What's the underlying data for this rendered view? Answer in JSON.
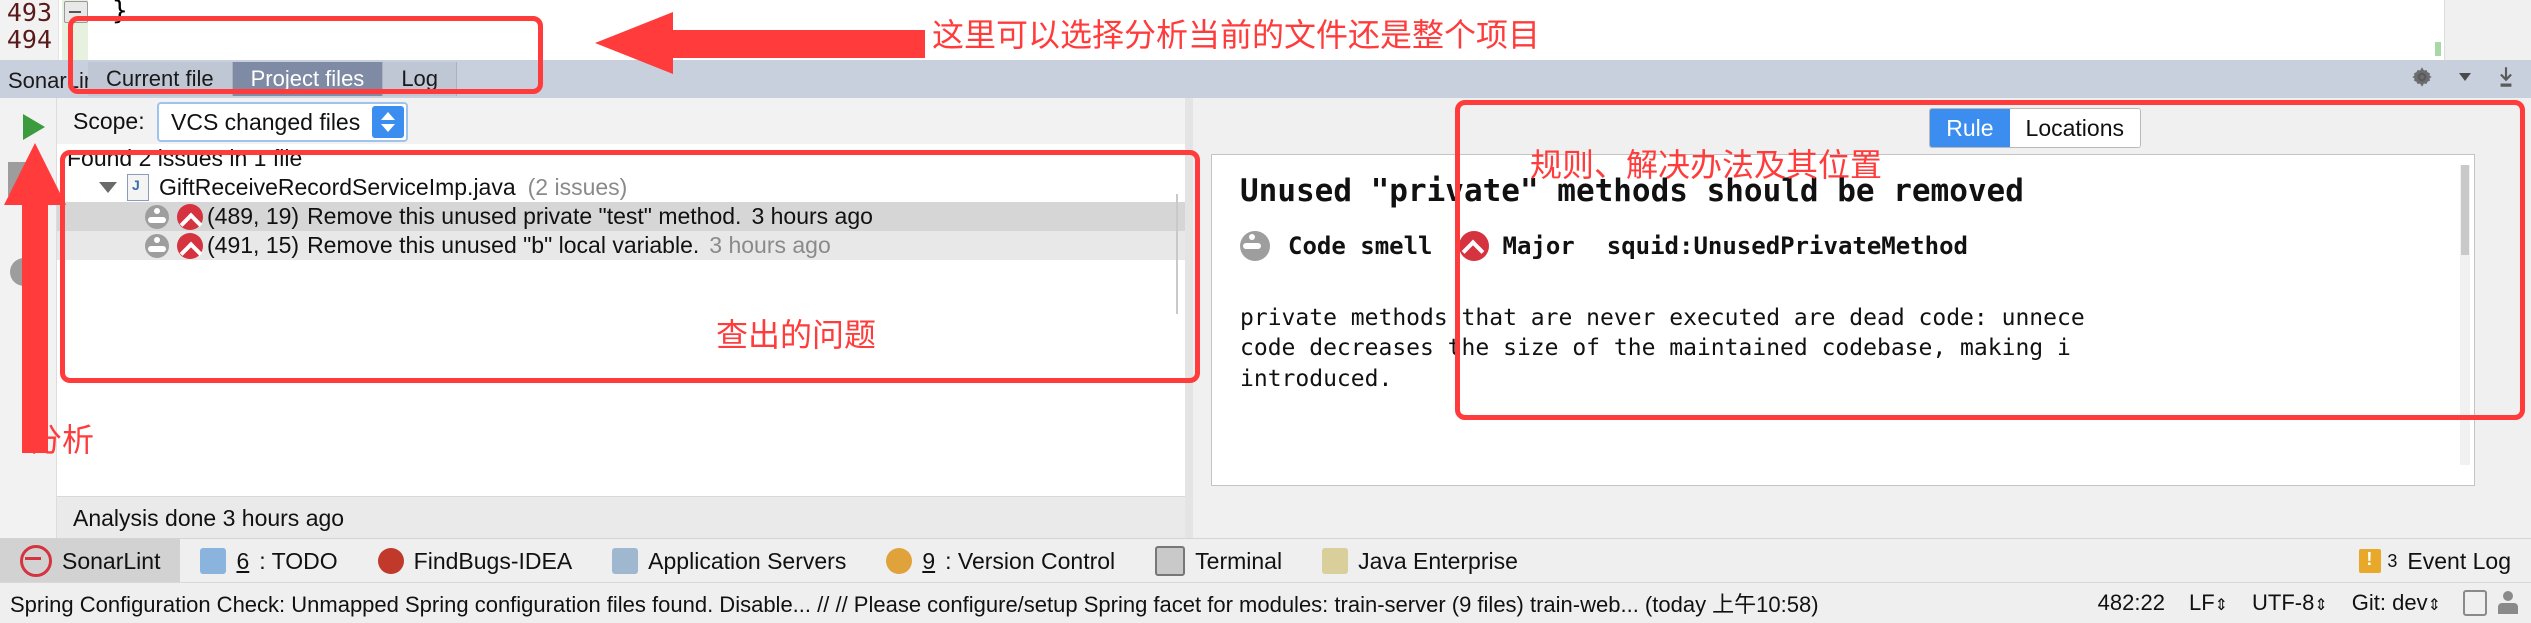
{
  "editor": {
    "line_numbers": [
      "493",
      "494"
    ],
    "code_text": "}"
  },
  "sonarlint_header": {
    "title": "SonarLint:",
    "tabs": [
      {
        "label": "Current file",
        "active": false
      },
      {
        "label": "Project files",
        "active": true
      },
      {
        "label": "Log",
        "active": false
      }
    ],
    "icons": [
      "gear-icon",
      "chevron-down-icon",
      "hide-window-icon"
    ]
  },
  "left_toolbar": {
    "buttons": [
      "run-analysis-icon",
      "stop-icon",
      "clear-icon"
    ]
  },
  "scope": {
    "label": "Scope:",
    "value": "VCS changed files"
  },
  "tree": {
    "summary": "Found 2 issues in 1 file",
    "file": {
      "name": "GiftReceiveRecordServiceImp.java",
      "count": "(2 issues)"
    },
    "issues": [
      {
        "location": "(489, 19)",
        "message": "Remove this unused private \"test\" method.",
        "time": "3 hours ago",
        "type_icon": "code-smell-icon",
        "severity_icon": "major-icon"
      },
      {
        "location": "(491, 15)",
        "message": "Remove this unused \"b\" local variable.",
        "time": "3 hours ago",
        "type_icon": "code-smell-icon",
        "severity_icon": "major-icon"
      }
    ],
    "status": "Analysis done 3 hours ago"
  },
  "right_panel": {
    "tabs": [
      {
        "label": "Rule",
        "active": true
      },
      {
        "label": "Locations",
        "active": false
      }
    ],
    "rule": {
      "title": "Unused \"private\" methods should be removed",
      "type": "Code smell",
      "severity": "Major",
      "key": "squid:UnusedPrivateMethod",
      "body_lines": [
        "private methods that are never executed are dead code: unnece",
        "code decreases the size of the maintained codebase, making i",
        "introduced."
      ]
    }
  },
  "tool_windows": [
    {
      "label": "SonarLint",
      "icon": "sonarlint-icon",
      "active": true,
      "num": ""
    },
    {
      "label": ": TODO",
      "icon": "todo-icon",
      "active": false,
      "num": "6"
    },
    {
      "label": "FindBugs-IDEA",
      "icon": "findbugs-icon",
      "active": false,
      "num": ""
    },
    {
      "label": "Application Servers",
      "icon": "app-servers-icon",
      "active": false,
      "num": ""
    },
    {
      "label": ": Version Control",
      "icon": "version-control-icon",
      "active": false,
      "num": "9"
    },
    {
      "label": "Terminal",
      "icon": "terminal-icon",
      "active": false,
      "num": ""
    },
    {
      "label": "Java Enterprise",
      "icon": "java-enterprise-icon",
      "active": false,
      "num": ""
    }
  ],
  "event_log": {
    "label": "Event Log",
    "count": "3"
  },
  "status_bar": {
    "message": "Spring Configuration Check: Unmapped Spring configuration files found. Disable... // // Please configure/setup Spring facet for modules: train-server (9 files) train-web... (today 上午10:58)",
    "caret": "482:22",
    "line_sep": "LF",
    "encoding": "UTF-8",
    "branch": "Git: dev",
    "icons": [
      "lock-icon",
      "inspector-icon"
    ]
  },
  "annotations": {
    "tabs_note": "这里可以选择分析当前的文件还是整个项目",
    "issues_note": "查出的问题",
    "analysis_note": "分析",
    "rule_note": "规则、解决办法及其位置",
    "color": "#ff3b3b"
  }
}
